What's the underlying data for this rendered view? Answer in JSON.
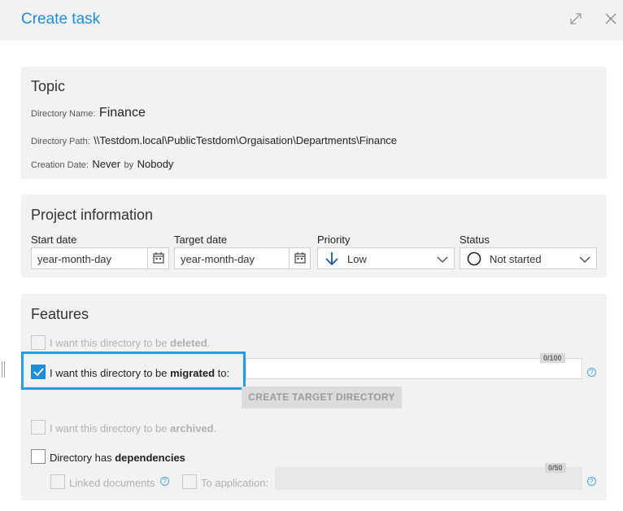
{
  "header": {
    "title": "Create task",
    "expand_icon": "expand-icon",
    "close_icon": "close-icon"
  },
  "topic": {
    "title": "Topic",
    "name_label": "Directory Name:",
    "name_value": "Finance",
    "path_label": "Directory Path:",
    "path_value": "\\\\Testdom.local\\PublicTestdom\\Orgaisation\\Departments\\Finance",
    "date_label": "Creation Date:",
    "date_value": "Never",
    "by_label": "by",
    "by_value": "Nobody"
  },
  "project": {
    "title": "Project information",
    "start_label": "Start date",
    "start_placeholder": "year-month-day",
    "target_label": "Target date",
    "target_placeholder": "year-month-day",
    "priority_label": "Priority",
    "priority_value": "Low",
    "status_label": "Status",
    "status_value": "Not started"
  },
  "features": {
    "title": "Features",
    "deleted": {
      "prefix": "I want this directory to be ",
      "bold": "deleted",
      "suffix": ".",
      "checked": false,
      "disabled": true
    },
    "migrated": {
      "prefix": "I want this directory to be ",
      "bold": "migrated",
      "suffix": " to:",
      "checked": true,
      "counter": "0/100"
    },
    "create_button": "CREATE TARGET DIRECTORY",
    "archived": {
      "prefix": "I want this directory to be ",
      "bold": "archived",
      "suffix": ".",
      "checked": false,
      "disabled": true
    },
    "dependencies": {
      "prefix": "Directory has ",
      "bold": "dependencies",
      "checked": false
    },
    "linked_documents": "Linked documents",
    "to_application": "To application:",
    "app_counter": "0/50"
  },
  "colors": {
    "accent": "#1e8ed8",
    "panel": "#f2f2f2"
  }
}
